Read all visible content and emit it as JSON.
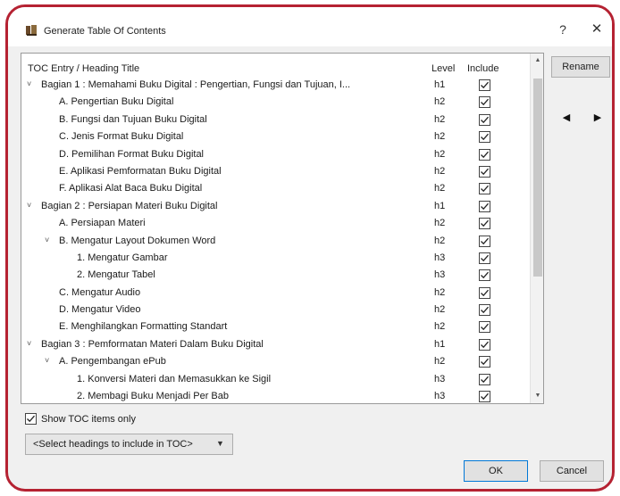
{
  "window": {
    "title": "Generate Table Of Contents",
    "help_label": "?",
    "close_label": "✕"
  },
  "list": {
    "col_title": "TOC Entry / Heading Title",
    "col_level": "Level",
    "col_include": "Include",
    "rows": [
      {
        "toggle": "˅",
        "depth": 0,
        "title": "Bagian 1 : Memahami Buku Digital : Pengertian, Fungsi dan Tujuan, I...",
        "level": "h1",
        "include": true
      },
      {
        "toggle": "",
        "depth": 1,
        "title": "A. Pengertian Buku Digital",
        "level": "h2",
        "include": true
      },
      {
        "toggle": "",
        "depth": 1,
        "title": "B. Fungsi dan Tujuan Buku Digital",
        "level": "h2",
        "include": true
      },
      {
        "toggle": "",
        "depth": 1,
        "title": "C. Jenis Format Buku Digital",
        "level": "h2",
        "include": true
      },
      {
        "toggle": "",
        "depth": 1,
        "title": "D. Pemilihan Format Buku Digital",
        "level": "h2",
        "include": true
      },
      {
        "toggle": "",
        "depth": 1,
        "title": "E. Aplikasi Pemformatan Buku Digital",
        "level": "h2",
        "include": true
      },
      {
        "toggle": "",
        "depth": 1,
        "title": "F. Aplikasi Alat Baca Buku Digital",
        "level": "h2",
        "include": true
      },
      {
        "toggle": "˅",
        "depth": 0,
        "title": "Bagian 2 : Persiapan Materi Buku Digital",
        "level": "h1",
        "include": true
      },
      {
        "toggle": "",
        "depth": 1,
        "title": "A. Persiapan Materi",
        "level": "h2",
        "include": true
      },
      {
        "toggle": "˅",
        "depth": 1,
        "title": "B. Mengatur Layout Dokumen Word",
        "level": "h2",
        "include": true
      },
      {
        "toggle": "",
        "depth": 2,
        "title": "1. Mengatur Gambar",
        "level": "h3",
        "include": true
      },
      {
        "toggle": "",
        "depth": 2,
        "title": "2. Mengatur Tabel",
        "level": "h3",
        "include": true
      },
      {
        "toggle": "",
        "depth": 1,
        "title": "C. Mengatur Audio",
        "level": "h2",
        "include": true
      },
      {
        "toggle": "",
        "depth": 1,
        "title": "D. Mengatur Video",
        "level": "h2",
        "include": true
      },
      {
        "toggle": "",
        "depth": 1,
        "title": "E. Menghilangkan Formatting Standart",
        "level": "h2",
        "include": true
      },
      {
        "toggle": "˅",
        "depth": 0,
        "title": "Bagian 3 : Pemformatan Materi Dalam Buku Digital",
        "level": "h1",
        "include": true
      },
      {
        "toggle": "˅",
        "depth": 1,
        "title": "A. Pengembangan ePub",
        "level": "h2",
        "include": true
      },
      {
        "toggle": "",
        "depth": 2,
        "title": "1. Konversi Materi dan Memasukkan ke Sigil",
        "level": "h3",
        "include": true
      },
      {
        "toggle": "",
        "depth": 2,
        "title": "2. Membagi Buku Menjadi Per Bab",
        "level": "h3",
        "include": true
      }
    ]
  },
  "side": {
    "rename_label": "Rename",
    "left_label": "◀",
    "right_label": "▶"
  },
  "options": {
    "show_toc_label": "Show TOC items only",
    "show_toc_checked": true,
    "select_value": "<Select headings to include in TOC>",
    "select_arrow": "▼"
  },
  "footer": {
    "ok_label": "OK",
    "cancel_label": "Cancel"
  }
}
